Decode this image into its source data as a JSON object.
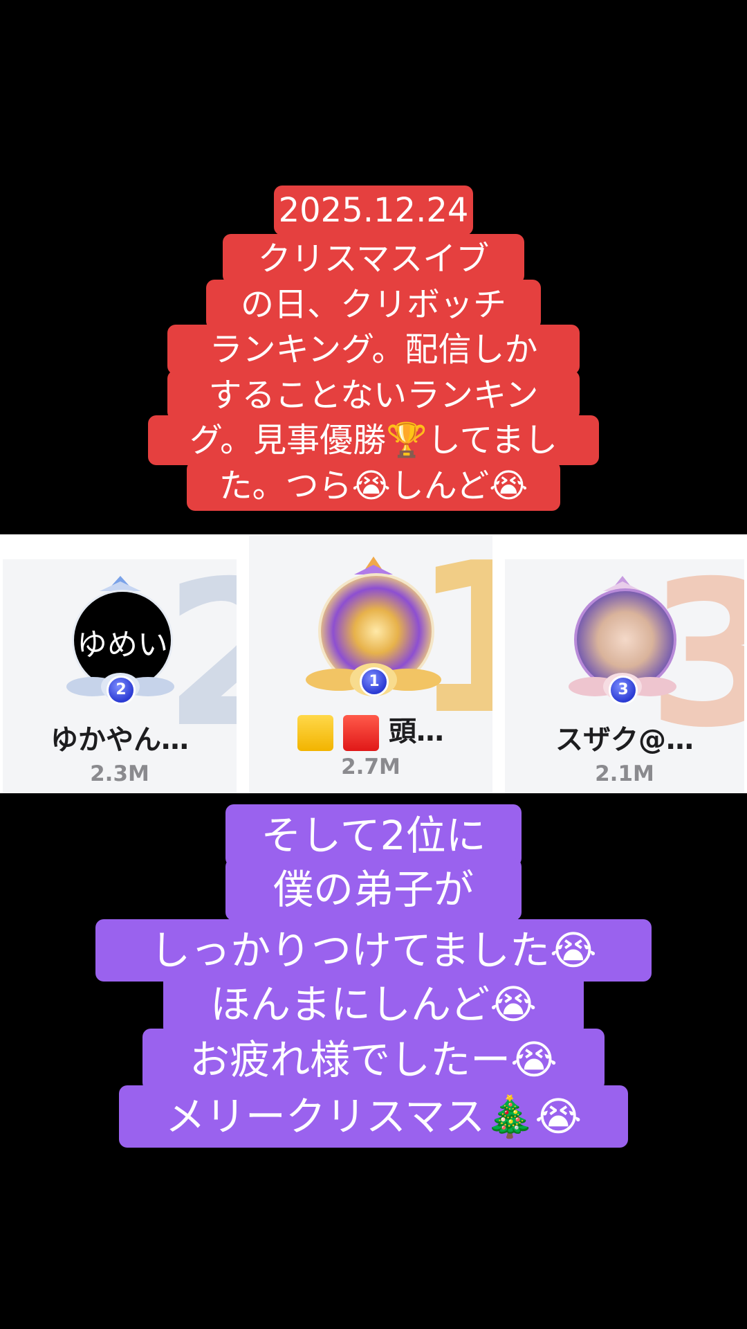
{
  "top_caption": {
    "lines": [
      "2025.12.24",
      "クリスマスイブ",
      "の日、クリボッチ",
      "ランキング。配信しか",
      "することないランキン",
      "グ。見事優勝🏆してまし",
      "た。つら😭しんど😭"
    ]
  },
  "ranking": {
    "entries": [
      {
        "rank": "2",
        "avatar_text": "ゆめい",
        "name": "ゆかやん…",
        "score": "2.3M"
      },
      {
        "rank": "1",
        "name_prefix_icons": [
          "yellow-square-icon",
          "red-square-icon"
        ],
        "name": "頭…",
        "score": "2.7M"
      },
      {
        "rank": "3",
        "name": "スザク@…",
        "score": "2.1M"
      }
    ]
  },
  "bottom_caption": {
    "lines": [
      "そして2位に",
      "僕の弟子が",
      "しっかりつけてました😭",
      "ほんまにしんど😭",
      "お疲れ様でしたー😭",
      "メリークリスマス🎄😭"
    ]
  },
  "colors": {
    "red_caption": "#e5403f",
    "purple_caption": "#9a62ee",
    "gold": "#f1c97a",
    "silver": "#cfd8e6",
    "bronze": "#f0c7b4"
  }
}
